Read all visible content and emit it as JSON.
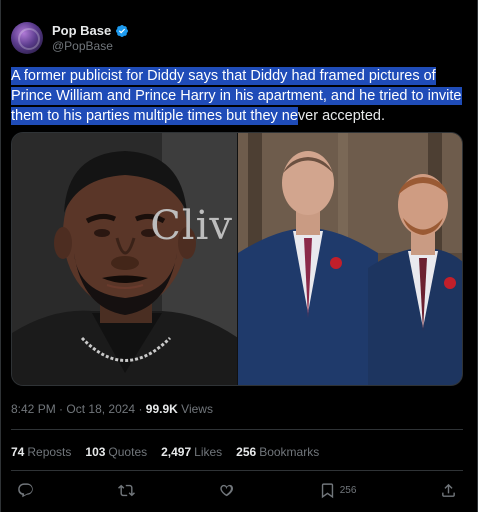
{
  "author": {
    "display_name": "Pop Base",
    "handle": "@PopBase"
  },
  "tweet": {
    "text_line1": "A former publicist for Diddy says that Diddy had framed pictures of",
    "text_line2": "Prince William and Prince Harry in his apartment, and he tried to invite",
    "text_line3a": "them to his parties multiple times but they ne",
    "text_line3b": "ver accepted.",
    "media_watermark": "Cliv"
  },
  "meta": {
    "time": "8:42 PM",
    "separator": "·",
    "date": "Oct 18, 2024",
    "separator2": "·",
    "views_count": "99.9K",
    "views_label": "Views"
  },
  "stats": {
    "reposts_count": "74",
    "reposts_label": "Reposts",
    "quotes_count": "103",
    "quotes_label": "Quotes",
    "likes_count": "2,497",
    "likes_label": "Likes",
    "bookmarks_count": "256",
    "bookmarks_label": "Bookmarks"
  },
  "actions": {
    "bookmark_count": "256"
  },
  "colors": {
    "background": "#000000",
    "text": "#e7e9ea",
    "muted": "#71767b",
    "highlight": "#1f4cb8",
    "verified": "#1d9bf0"
  },
  "icons": [
    "verified-badge-icon",
    "reply-icon",
    "repost-icon",
    "like-icon",
    "bookmark-icon",
    "share-icon"
  ]
}
